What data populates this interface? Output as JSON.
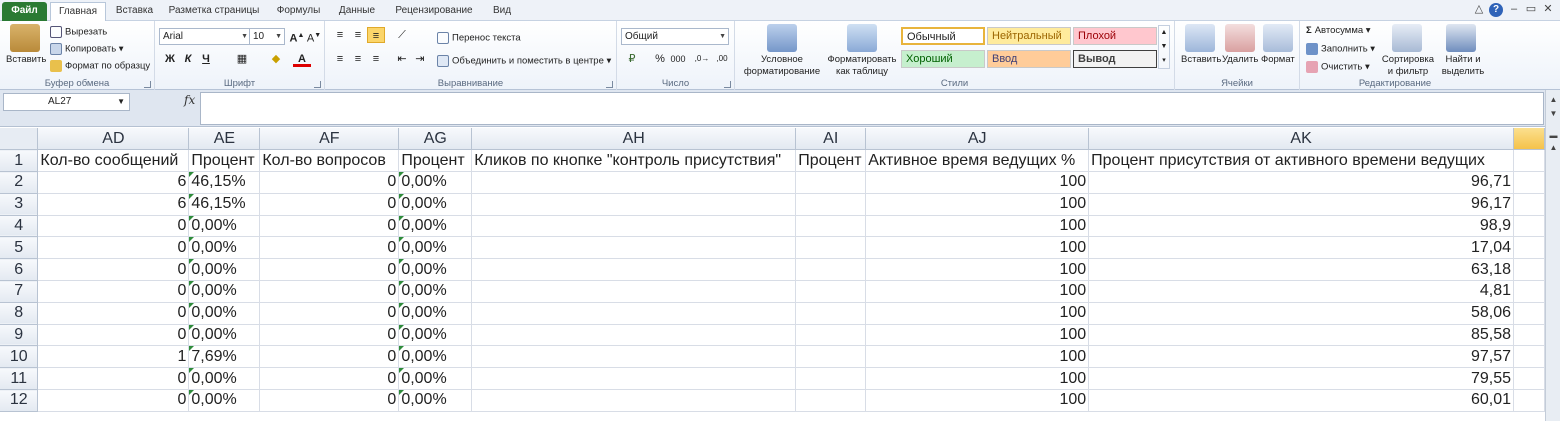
{
  "menu": {
    "file": "Файл",
    "tabs": [
      "Главная",
      "Вставка",
      "Разметка страницы",
      "Формулы",
      "Данные",
      "Рецензирование",
      "Вид"
    ]
  },
  "ribbon": {
    "clipboard": {
      "paste": "Вставить",
      "cut": "Вырезать",
      "copy": "Копировать",
      "format_painter": "Формат по образцу",
      "label": "Буфер обмена"
    },
    "font": {
      "name": "Arial",
      "size": "10",
      "bold": "Ж",
      "italic": "К",
      "underline": "Ч",
      "label": "Шрифт"
    },
    "alignment": {
      "wrap": "Перенос текста",
      "merge": "Объединить и поместить в центре",
      "label": "Выравнивание"
    },
    "number": {
      "format": "Общий",
      "percent": "%",
      "thousands": "000",
      "label": "Число"
    },
    "styles": {
      "conditional": "Условное форматирование",
      "as_table": "Форматировать как таблицу",
      "cells": [
        "Обычный",
        "Нейтральный",
        "Плохой",
        "Хороший",
        "Ввод",
        "Вывод"
      ],
      "label": "Стили"
    },
    "cells": {
      "insert": "Вставить",
      "delete": "Удалить",
      "format": "Формат",
      "label": "Ячейки"
    },
    "editing": {
      "autosum": "Автосумма",
      "fill": "Заполнить",
      "clear": "Очистить",
      "sort": "Сортировка и фильтр",
      "find": "Найти и выделить",
      "label": "Редактирование"
    }
  },
  "formula_bar": {
    "name_box": "AL27",
    "fx": "fx",
    "value": ""
  },
  "sheet": {
    "columns": [
      "AD",
      "AE",
      "AF",
      "AG",
      "AH",
      "AI",
      "AJ",
      "AK",
      ""
    ],
    "headers": [
      "Кол-во сообщений",
      "Процент",
      "Кол-во вопросов",
      "Процент",
      "Кликов по кнопке \"контроль присутствия\"",
      "Процент",
      "Активное время ведущих %",
      "Процент присутствия от активного времени ведущих",
      ""
    ],
    "rows": [
      {
        "n": "2",
        "ad": "6",
        "ae": "46,15%",
        "af": "0",
        "ag": "0,00%",
        "aj": "100",
        "ak": "96,71"
      },
      {
        "n": "3",
        "ad": "6",
        "ae": "46,15%",
        "af": "0",
        "ag": "0,00%",
        "aj": "100",
        "ak": "96,17"
      },
      {
        "n": "4",
        "ad": "0",
        "ae": "0,00%",
        "af": "0",
        "ag": "0,00%",
        "aj": "100",
        "ak": "98,9"
      },
      {
        "n": "5",
        "ad": "0",
        "ae": "0,00%",
        "af": "0",
        "ag": "0,00%",
        "aj": "100",
        "ak": "17,04"
      },
      {
        "n": "6",
        "ad": "0",
        "ae": "0,00%",
        "af": "0",
        "ag": "0,00%",
        "aj": "100",
        "ak": "63,18"
      },
      {
        "n": "7",
        "ad": "0",
        "ae": "0,00%",
        "af": "0",
        "ag": "0,00%",
        "aj": "100",
        "ak": "4,81"
      },
      {
        "n": "8",
        "ad": "0",
        "ae": "0,00%",
        "af": "0",
        "ag": "0,00%",
        "aj": "100",
        "ak": "58,06"
      },
      {
        "n": "9",
        "ad": "0",
        "ae": "0,00%",
        "af": "0",
        "ag": "0,00%",
        "aj": "100",
        "ak": "85,58"
      },
      {
        "n": "10",
        "ad": "1",
        "ae": "7,69%",
        "af": "0",
        "ag": "0,00%",
        "aj": "100",
        "ak": "97,57"
      },
      {
        "n": "11",
        "ad": "0",
        "ae": "0,00%",
        "af": "0",
        "ag": "0,00%",
        "aj": "100",
        "ak": "79,55"
      },
      {
        "n": "12",
        "ad": "0",
        "ae": "0,00%",
        "af": "0",
        "ag": "0,00%",
        "aj": "100",
        "ak": "60,01"
      }
    ]
  }
}
